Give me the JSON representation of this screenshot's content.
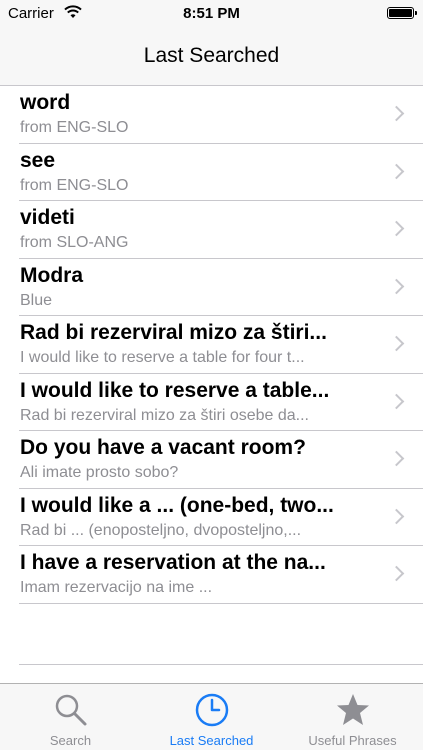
{
  "status_bar": {
    "carrier": "Carrier",
    "time": "8:51 PM",
    "battery_level": 1.0
  },
  "nav": {
    "title": "Last Searched"
  },
  "list": [
    {
      "title": "word",
      "subtitle": "from ENG-SLO"
    },
    {
      "title": "see",
      "subtitle": "from ENG-SLO"
    },
    {
      "title": "videti",
      "subtitle": "from SLO-ANG"
    },
    {
      "title": "Modra",
      "subtitle": "Blue"
    },
    {
      "title": "Rad bi rezerviral mizo za štiri...",
      "subtitle": "I would like to reserve a table for four t..."
    },
    {
      "title": "I would like to reserve a table...",
      "subtitle": "Rad bi rezerviral mizo za štiri osebe da..."
    },
    {
      "title": "Do you have a vacant room?",
      "subtitle": "Ali imate prosto sobo?"
    },
    {
      "title": "I would like a ... (one-bed, two...",
      "subtitle": "Rad bi ... (enoposteljno, dvoposteljno,..."
    },
    {
      "title": "I have a reservation at the na...",
      "subtitle": "Imam rezervacijo na ime ..."
    }
  ],
  "tabs": [
    {
      "label": "Search",
      "icon": "search-icon",
      "active": false
    },
    {
      "label": "Last Searched",
      "icon": "clock-icon",
      "active": true
    },
    {
      "label": "Useful Phrases",
      "icon": "star-icon",
      "active": false
    }
  ],
  "colors": {
    "accent": "#1a7cf5",
    "inactive": "#8e8e93",
    "bar_background": "#f7f7f7",
    "separator": "#c8c7cc"
  }
}
